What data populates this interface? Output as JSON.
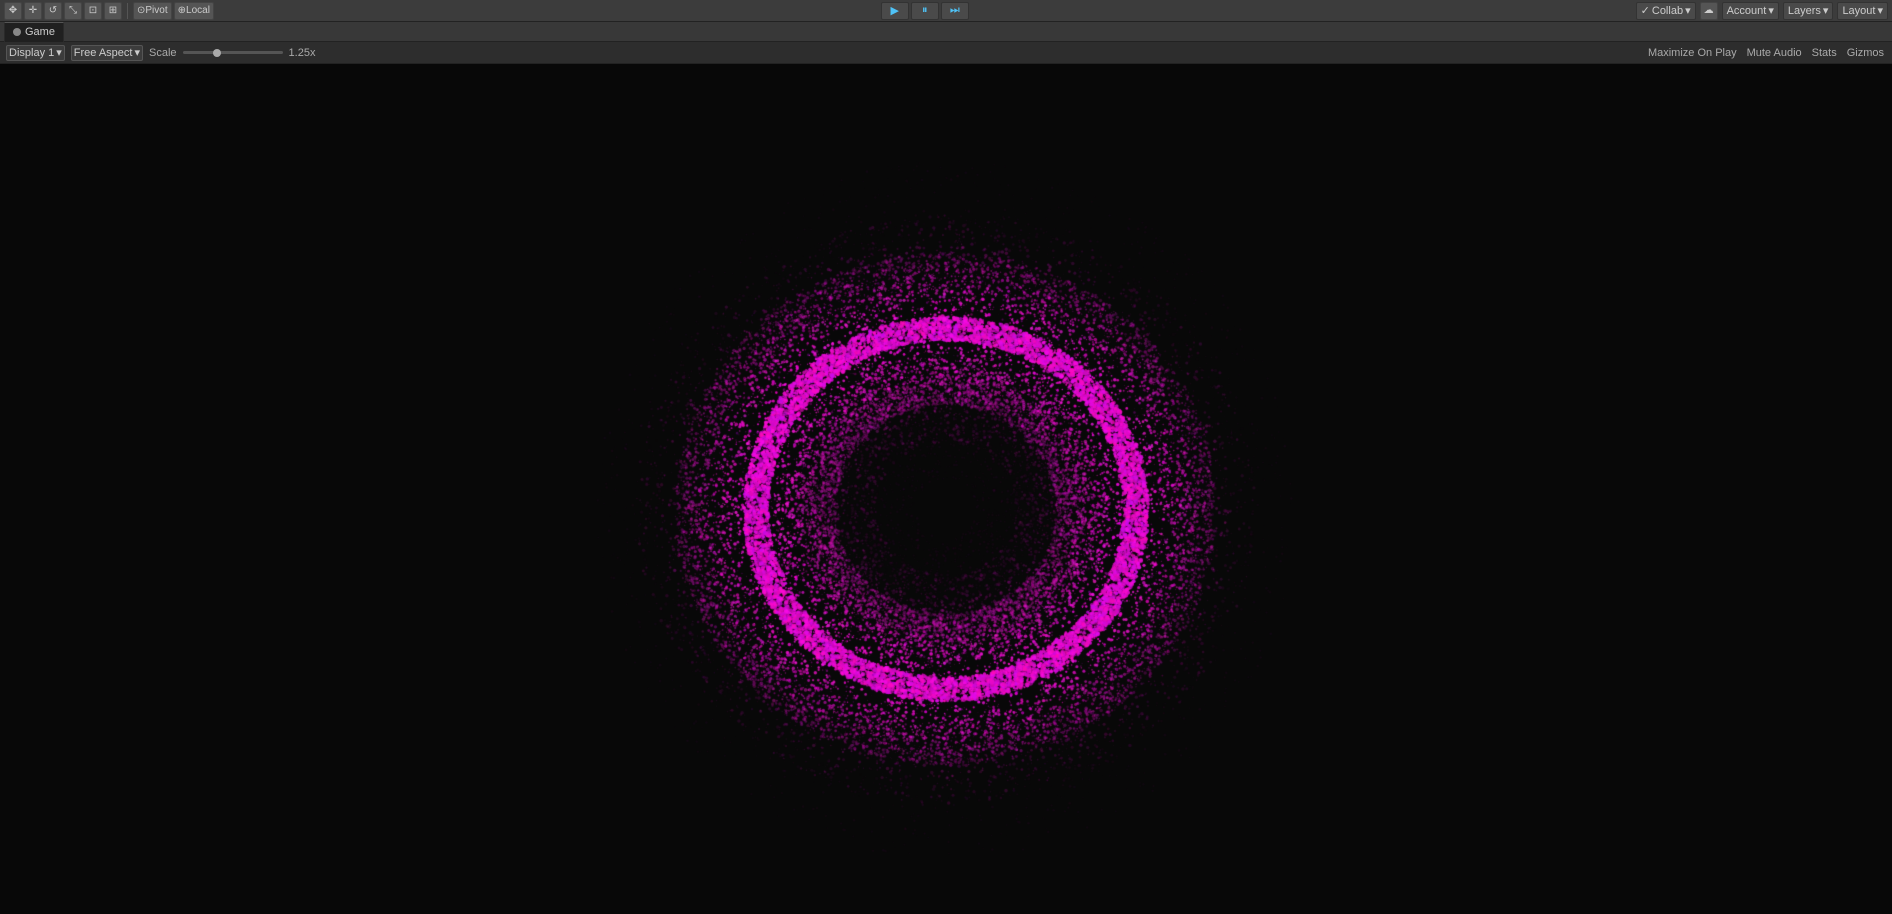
{
  "toolbar": {
    "pivot_label": "Pivot",
    "local_label": "Local",
    "play_label": "▶",
    "pause_label": "⏸",
    "step_label": "⏭",
    "collab_label": "Collab",
    "cloud_label": "☁",
    "account_label": "Account",
    "layers_label": "Layers",
    "layout_label": "Layout"
  },
  "tab": {
    "icon": "●",
    "label": "Game"
  },
  "game_toolbar": {
    "display_label": "Display 1",
    "aspect_label": "Free Aspect",
    "scale_label": "Scale",
    "scale_value": "1.25x",
    "maximize_label": "Maximize On Play",
    "mute_label": "Mute Audio",
    "stats_label": "Stats",
    "gizmos_label": "Gizmos"
  },
  "viewport": {
    "background": "#080808"
  }
}
